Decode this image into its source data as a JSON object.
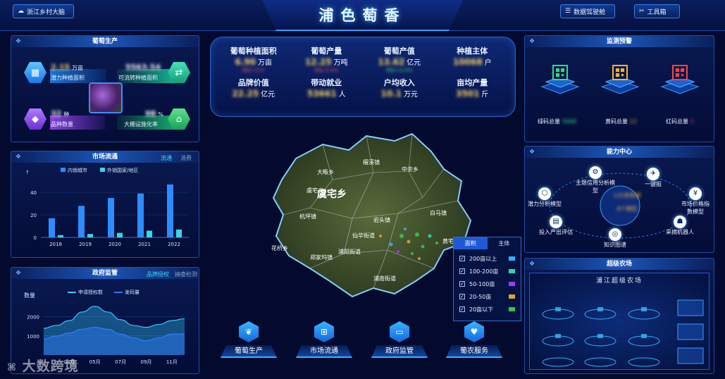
{
  "header": {
    "brain_button": "浙江乡村大脑",
    "title": "浦色萄香",
    "cockpit_button": "数据驾驶舱",
    "toolbox_button": "工具箱"
  },
  "production": {
    "title": "葡萄生产",
    "potential_area_value": "2.15",
    "potential_area_unit": "万亩",
    "potential_area_label": "潜力种植面积",
    "transfer_area_value": "5563.54",
    "transfer_area_label": "可流转种植面积",
    "variety_value": "32",
    "variety_unit": "种",
    "variety_label": "品种数量",
    "greenhouse_value": "98",
    "greenhouse_unit": "%",
    "greenhouse_label": "大棚设施化率"
  },
  "market": {
    "title": "市场流通",
    "tab_active": "流通",
    "tab_inactive": "消费",
    "legend_domestic": "内销城市",
    "legend_foreign": "外销国家/地区",
    "arrow_label": "↑"
  },
  "gov": {
    "title": "政府监管",
    "tab_active": "品牌授权",
    "tab_inactive": "抽查检测",
    "ylabel": "数量",
    "legend_apply": "申请授权数",
    "legend_issue": "发码量"
  },
  "chart_data": [
    {
      "type": "bar",
      "categories": [
        "2018",
        "2019",
        "2020",
        "2021",
        "2022"
      ],
      "series": [
        {
          "name": "内销城市",
          "values": [
            17,
            28,
            35,
            39,
            47
          ]
        },
        {
          "name": "外销国家/地区",
          "values": [
            2,
            3,
            4,
            6,
            7
          ]
        }
      ],
      "yticks": [
        "0",
        "20",
        "40"
      ],
      "ylim": [
        0,
        50
      ],
      "grid": true,
      "legend": "top"
    },
    {
      "type": "area",
      "x": [
        "01月",
        "02月",
        "03月",
        "04月",
        "05月",
        "06月",
        "07月",
        "08月",
        "09月",
        "10月",
        "11月",
        "12月"
      ],
      "xticks": [
        "03月",
        "05月",
        "07月",
        "09月",
        "11月"
      ],
      "series": [
        {
          "name": "申请授权数",
          "values": [
            1400,
            1550,
            1800,
            2250,
            2550,
            2250,
            1850,
            1550,
            1450,
            1600,
            1800,
            1900
          ]
        },
        {
          "name": "发码量",
          "values": [
            850,
            1000,
            1150,
            1350,
            1450,
            1350,
            1100,
            900,
            750,
            900,
            1100,
            1100
          ]
        }
      ],
      "yticks": [
        "1000",
        "2000"
      ],
      "ylim": [
        0,
        2800
      ],
      "grid": true,
      "legend": "top"
    }
  ],
  "stats": {
    "area_label": "葡萄种植面积",
    "area_value": "6.90",
    "area_unit": "万亩",
    "area_sub": "同比-12%",
    "output_label": "葡萄产量",
    "output_value": "12.25",
    "output_unit": "万吨",
    "output_sub": "同比-5.6%",
    "value_label": "葡萄产值",
    "value_value": "13.62",
    "value_unit": "亿元",
    "value_sub": "同比+9.8%",
    "grower_label": "种植主体",
    "grower_value": "10068",
    "grower_unit": "户",
    "brand_label": "品牌价值",
    "brand_value": "22.25",
    "brand_unit": "亿元",
    "jobs_label": "带动就业",
    "jobs_value": "53661",
    "jobs_unit": "人",
    "income_label": "户均收入",
    "income_value": "10.1",
    "income_unit": "万元",
    "yield_label": "亩均产量",
    "yield_value": "3501",
    "yield_unit": "斤"
  },
  "map": {
    "towns": [
      "檀溪镇",
      "大畈乡",
      "中余乡",
      "虞宅乡",
      "杭坪镇",
      "岩头镇",
      "白马镇",
      "浦南街道",
      "仙华街道",
      "黄宅镇",
      "花桥乡",
      "浦阳街道",
      "郑家坞镇"
    ],
    "legend_tab_area": "面积",
    "legend_tab_subject": "主体",
    "legend_rows": [
      "200亩以上",
      "100-200亩",
      "50-100亩",
      "20-50亩",
      "20亩以下"
    ],
    "legend_colors": [
      "#2fb1ff",
      "#2ed3b4",
      "#9b3cff",
      "#e0a038",
      "#3cc24a"
    ]
  },
  "nav": {
    "production": "葡萄生产",
    "market": "市场流通",
    "gov": "政府监管",
    "service": "葡农服务"
  },
  "warning": {
    "title": "监测预警",
    "green_label": "绿码总量",
    "green_value": "5668",
    "yellow_label": "黄码总量",
    "yellow_value": "12",
    "red_label": "红码总量",
    "red_value": "3",
    "green_color": "#2fe07a",
    "yellow_color": "#f3b431",
    "red_color": "#ff4242"
  },
  "capability": {
    "title": "能力中心",
    "center_line1": "125条数据",
    "center_line2": "8个模型",
    "nodes": [
      "主题信用分析模型",
      "一键报",
      "市场价格指数模型",
      "采摘机器人",
      "知识图谱",
      "投入产出评估",
      "潜力分析模型"
    ]
  },
  "farm": {
    "title": "超级农场",
    "banner": "浦江超级农场"
  },
  "watermark": "大数跨境"
}
